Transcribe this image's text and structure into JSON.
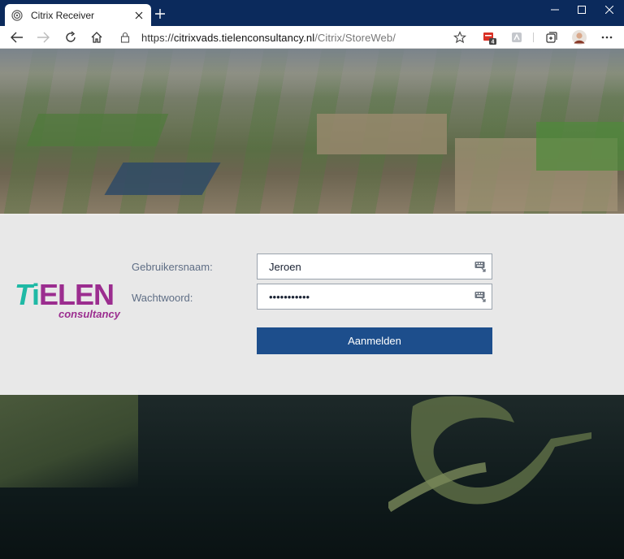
{
  "browser": {
    "tab_title": "Citrix Receiver",
    "url_scheme": "https://",
    "url_host": "citrixvads.tielenconsultancy.nl",
    "url_path": "/Citrix/StoreWeb/",
    "extension_badge": "4"
  },
  "logo": {
    "main_t": "T",
    "main_i": "i",
    "main_rest": "ELEN",
    "sub": "consultancy",
    "colors": {
      "teal": "#1fb9a5",
      "purple": "#9b2d8f"
    }
  },
  "form": {
    "username_label": "Gebruikersnaam:",
    "username_value": "Jeroen",
    "password_label": "Wachtwoord:",
    "password_value": "•••••••••••",
    "submit_label": "Aanmelden",
    "accent_color": "#1d4e8c"
  },
  "icons": {
    "tab": "citrix-favicon",
    "field": "keyboard-icon",
    "address": "lock-icon"
  }
}
